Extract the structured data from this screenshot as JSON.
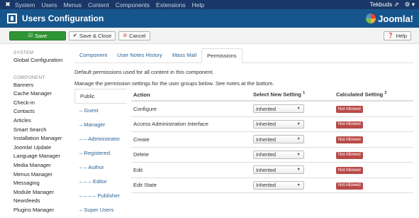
{
  "topnav": {
    "menu": [
      "System",
      "Users",
      "Menus",
      "Content",
      "Components",
      "Extensions",
      "Help"
    ],
    "user": "Tekbuds",
    "user_caret": "▾",
    "settings_caret": "▾"
  },
  "header": {
    "title": "Users Configuration",
    "brand": "Joomla!"
  },
  "toolbar": {
    "save_label": "Save",
    "save_close_label": "Save & Close",
    "cancel_label": "Cancel",
    "help_label": "Help"
  },
  "sidebar": {
    "system_caption": "SYSTEM",
    "system_items": [
      "Global Configuration"
    ],
    "component_caption": "COMPONENT",
    "component_items": [
      "Banners",
      "Cache Manager",
      "Check-in",
      "Contacts",
      "Articles",
      "Smart Search",
      "Installation Manager",
      "Joomla! Update",
      "Language Manager",
      "Media Manager",
      "Menus Manager",
      "Messaging",
      "Module Manager",
      "Newsfeeds",
      "Plugins Manager"
    ]
  },
  "tabs": [
    "Component",
    "User Notes History",
    "Mass Mail",
    "Permissions"
  ],
  "active_tab": 3,
  "description": "Default permissions used for all content in this component.",
  "manage_note": "Manage the permission settings for the user groups below. See notes at the bottom.",
  "groups": [
    "Public",
    "– Guest",
    "– Manager",
    "– – Administrator",
    "– Registered",
    "– – Author",
    "– – – Editor",
    "– – – – Publisher",
    "– Super Users"
  ],
  "permissions": {
    "headers": {
      "action": "Action",
      "select": "Select New Setting",
      "select_note": "1",
      "calculated": "Calculated Setting",
      "calculated_note": "2"
    },
    "rows": [
      {
        "action": "Configure",
        "setting": "Inherited",
        "calculated": "Not Allowed"
      },
      {
        "action": "Access Administration Interface",
        "setting": "Inherited",
        "calculated": "Not Allowed"
      },
      {
        "action": "Create",
        "setting": "Inherited",
        "calculated": "Not Allowed"
      },
      {
        "action": "Delete",
        "setting": "Inherited",
        "calculated": "Not Allowed"
      },
      {
        "action": "Edit",
        "setting": "Inherited",
        "calculated": "Not Allowed"
      },
      {
        "action": "Edit State",
        "setting": "Inherited",
        "calculated": "Not Allowed"
      }
    ]
  },
  "colors": {
    "topnav_bg": "#1a3867",
    "header_bg": "#17568c",
    "save_green": "#2f9434",
    "badge_red": "#b94a48",
    "link_blue": "#2a6496"
  }
}
